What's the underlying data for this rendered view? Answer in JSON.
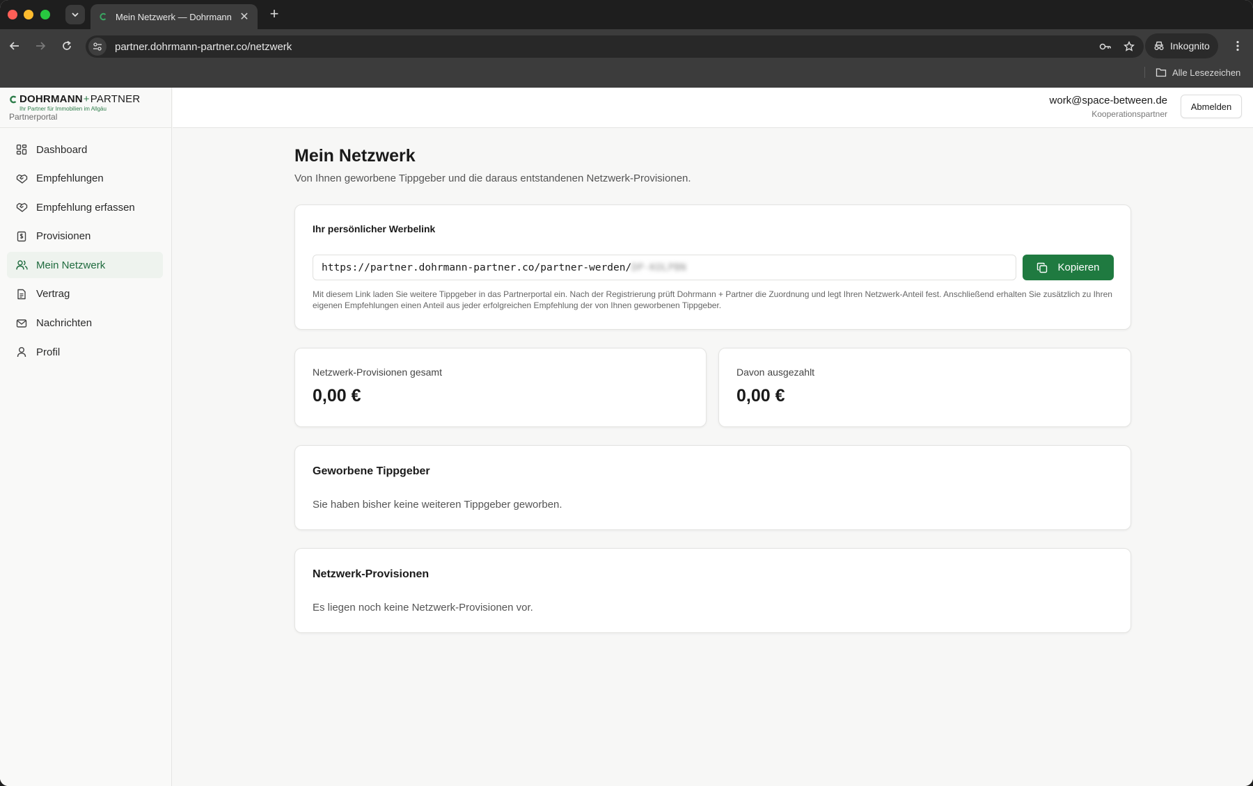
{
  "browser": {
    "tab_title": "Mein Netzwerk — Dohrmann",
    "url": "partner.dohrmann-partner.co/netzwerk",
    "incognito_label": "Inkognito",
    "bookmarks_label": "Alle Lesezeichen"
  },
  "brand": {
    "name_main": "DOHRMANN",
    "name_plus": "+",
    "name_partner": "PARTNER",
    "tagline": "Ihr Partner für Immobilien im Allgäu",
    "portal_label": "Partnerportal",
    "accent_color": "#1f7a40"
  },
  "sidebar": {
    "items": [
      {
        "label": "Dashboard",
        "icon": "grid-icon"
      },
      {
        "label": "Empfehlungen",
        "icon": "handshake-icon"
      },
      {
        "label": "Empfehlung erfassen",
        "icon": "handshake-plus-icon"
      },
      {
        "label": "Provisionen",
        "icon": "receipt-icon"
      },
      {
        "label": "Mein Netzwerk",
        "icon": "users-icon",
        "active": true
      },
      {
        "label": "Vertrag",
        "icon": "document-icon"
      },
      {
        "label": "Nachrichten",
        "icon": "mail-icon"
      },
      {
        "label": "Profil",
        "icon": "user-icon"
      }
    ]
  },
  "header": {
    "user_email": "work@space-between.de",
    "user_role": "Kooperationspartner",
    "logout_label": "Abmelden"
  },
  "main": {
    "title": "Mein Netzwerk",
    "subtitle": "Von Ihnen geworbene Tippgeber und die daraus entstandenen Netzwerk-Provisionen.",
    "referral": {
      "label": "Ihr persönlicher Werbelink",
      "link_prefix": "https://partner.dohrmann-partner.co/partner-werden/",
      "link_code": "DP-KOLPBN",
      "copy_label": "Kopieren",
      "help_text": "Mit diesem Link laden Sie weitere Tippgeber in das Partnerportal ein. Nach der Registrierung prüft Dohrmann + Partner die Zuordnung und legt Ihren Netzwerk-Anteil fest. Anschließend erhalten Sie zusätzlich zu Ihren eigenen Empfehlungen einen Anteil aus jeder erfolgreichen Empfehlung der von Ihnen geworbenen Tippgeber."
    },
    "stats": {
      "total_label": "Netzwerk-Provisionen gesamt",
      "total_value": "0,00 €",
      "paid_label": "Davon ausgezahlt",
      "paid_value": "0,00 €"
    },
    "referred": {
      "title": "Geworbene Tippgeber",
      "empty_text": "Sie haben bisher keine weiteren Tippgeber geworben."
    },
    "commissions": {
      "title": "Netzwerk-Provisionen",
      "empty_text": "Es liegen noch keine Netzwerk-Provisionen vor."
    }
  }
}
